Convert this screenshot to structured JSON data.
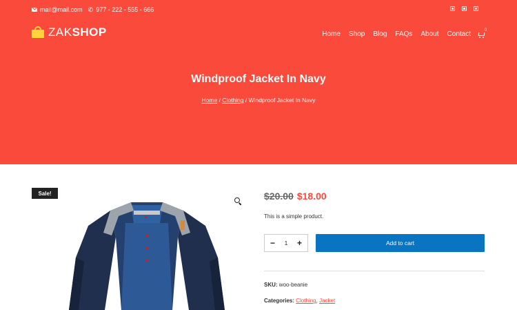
{
  "topbar": {
    "email": "mail@mail.com",
    "phone": "977 - 222 - 555 - 666"
  },
  "brand": {
    "logo_light": "ZAK",
    "logo_bold": "SHOP"
  },
  "nav": {
    "items": [
      "Home",
      "Shop",
      "Blog",
      "FAQs",
      "About",
      "Contact"
    ],
    "cart_count": "0"
  },
  "hero": {
    "title": "Windproof Jacket In Navy",
    "breadcrumb": {
      "home": "Home",
      "category": "Clothing",
      "current": "Windproof Jacket In Navy",
      "separator": " / "
    }
  },
  "product": {
    "badge": "Sale!",
    "old_price": "$20.00",
    "new_price": "$18.00",
    "description": "This is a simple product.",
    "quantity": "1",
    "decrement": "−",
    "increment": "+",
    "add_to_cart": "Add to cart",
    "sku_label": "SKU:",
    "sku_value": "woo-beanie",
    "categories_label": "Categories:",
    "categories": [
      "Clothing",
      "Jacket"
    ],
    "categories_sep": ", "
  },
  "icons": {
    "email": "envelope-icon",
    "phone": "phone-icon",
    "cart": "cart-icon",
    "zoom": "search-zoom-icon",
    "social": [
      "social-icon",
      "social-icon",
      "social-icon"
    ]
  },
  "colors": {
    "accent": "#f94a3c",
    "button": "#0874c2",
    "logo_bag": "#ffd43b",
    "badge": "#222222"
  }
}
